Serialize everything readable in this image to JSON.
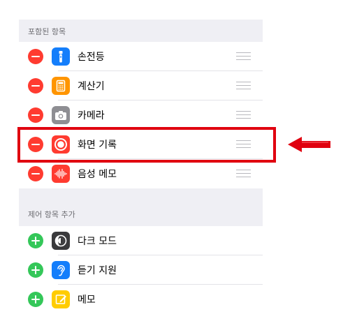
{
  "included_section": {
    "header": "포함된 항목",
    "items": [
      {
        "label": "손전등",
        "icon": "flashlight-icon",
        "icon_color": "#147efb"
      },
      {
        "label": "계산기",
        "icon": "calculator-icon",
        "icon_color": "#ff9500"
      },
      {
        "label": "카메라",
        "icon": "camera-icon",
        "icon_color": "#8e8e93"
      },
      {
        "label": "화면 기록",
        "icon": "screen-record-icon",
        "icon_color": "#ff3b30"
      },
      {
        "label": "음성 메모",
        "icon": "voice-memo-icon",
        "icon_color": "#ff3b30"
      }
    ]
  },
  "more_section": {
    "header": "제어 항목 추가",
    "items": [
      {
        "label": "다크 모드",
        "icon": "dark-mode-icon",
        "icon_color": "#3a3a3c"
      },
      {
        "label": "듣기 지원",
        "icon": "hearing-icon",
        "icon_color": "#147efb"
      },
      {
        "label": "메모",
        "icon": "notes-icon",
        "icon_color": "#ffcc00"
      }
    ]
  },
  "annotation": {
    "highlight_color": "#e0000f",
    "arrow_color": "#e0000f"
  }
}
